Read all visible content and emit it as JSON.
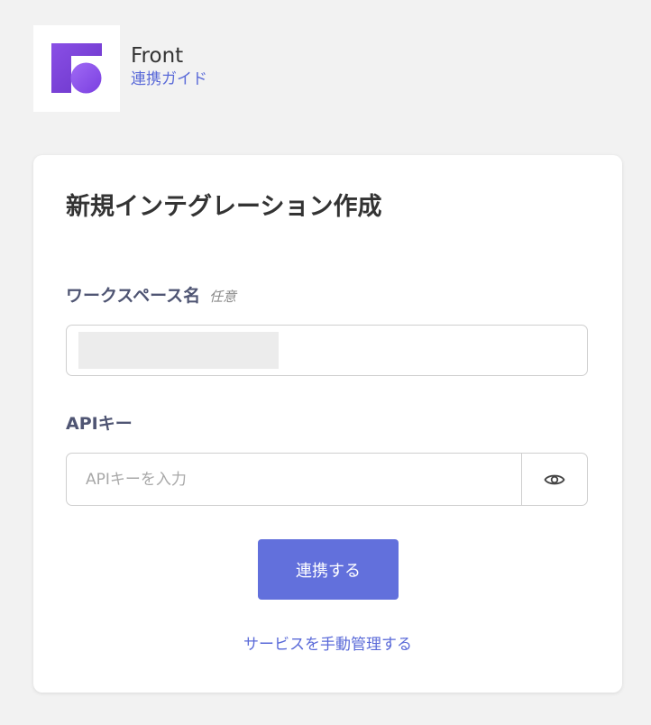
{
  "header": {
    "app_name": "Front",
    "guide_link": "連携ガイド",
    "logo_icon": "front-logo-icon",
    "logo_colors": [
      "#7a45d8",
      "#9a5cf0"
    ]
  },
  "card": {
    "title": "新規インテグレーション作成",
    "workspace": {
      "label": "ワークスペース名",
      "optional_tag": "任意",
      "value": ""
    },
    "api_key": {
      "label": "APIキー",
      "placeholder": "APIキーを入力",
      "toggle_icon": "eye-icon"
    },
    "submit_label": "連携する",
    "manual_link": "サービスを手動管理する"
  },
  "colors": {
    "accent": "#6270dc",
    "link": "#5a6ad8",
    "background": "#f2f2f2"
  }
}
